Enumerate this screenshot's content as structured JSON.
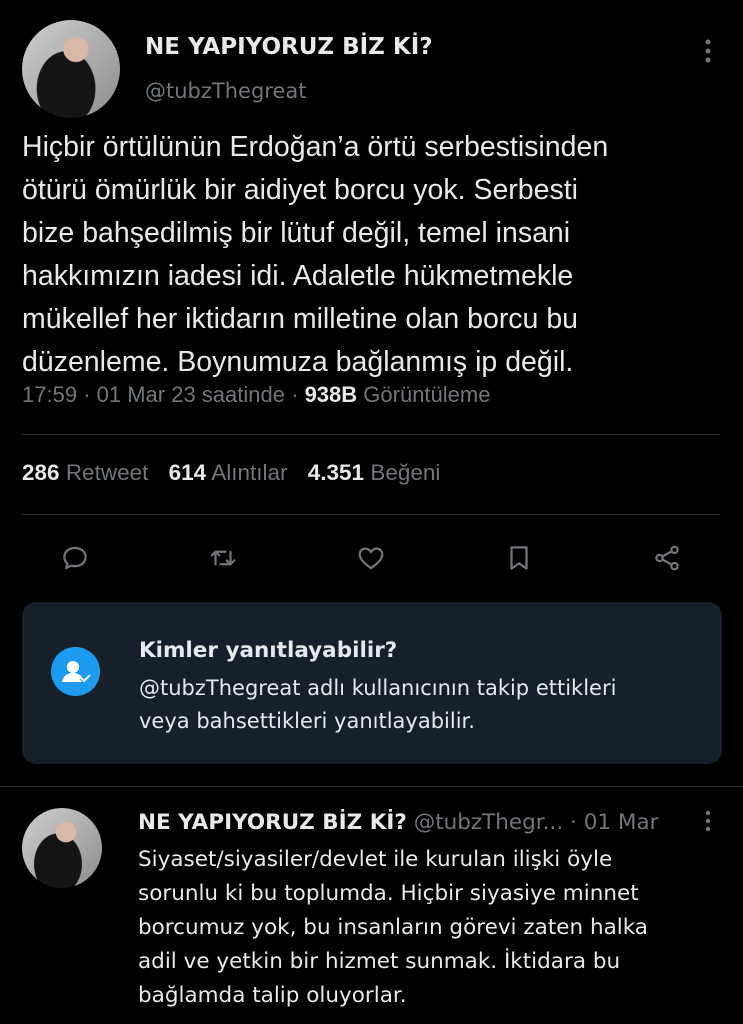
{
  "tweet": {
    "display_name": "NE YAPIYORUZ BİZ Kİ?",
    "handle": "@tubzThegreat",
    "text_lines": [
      "Hiçbir örtülünün Erdoğan’a örtü serbestisinden",
      "ötürü ömürlük bir aidiyet borcu yok. Serbesti",
      "bize bahşedilmiş bir lütuf değil, temel insani",
      "hakkımızın iadesi idi. Adaletle hükmetmekle",
      "mükellef her iktidarın milletine olan borcu bu",
      "düzenleme. Boynumuza bağlanmış ip değil."
    ],
    "time": "17:59",
    "sep1": "·",
    "date": "01 Mar 23 saatinde",
    "sep2": "·",
    "views_count": "938B",
    "views_label": "Görüntüleme",
    "stats": {
      "retweets": "286",
      "retweets_label": "Retweet",
      "quotes": "614",
      "quotes_label": "Alıntılar",
      "likes": "4.351",
      "likes_label": "Beğeni"
    }
  },
  "actions": {
    "icons": [
      "reply-icon",
      "retweet-icon",
      "like-icon",
      "bookmark-icon",
      "share-icon"
    ]
  },
  "reply_notice": {
    "title": "Kimler yanıtlayabilir?",
    "line1": "@tubzThegreat adlı kullanıcının takip ettikleri",
    "line2": "veya bahsettikleri yanıtlayabilir.",
    "accent": "#1d9bf0",
    "background": "#15202b"
  },
  "reply": {
    "display_name": "NE YAPIYORUZ BİZ Kİ?",
    "handle": "@tubzThegr...",
    "date": "· 01 Mar",
    "text_lines": [
      "Siyaset/siyasiler/devlet ile kurulan ilişki öyle",
      "sorunlu ki bu toplumda. Hiçbir siyasiye minnet",
      "borcumuz yok, bu insanların görevi zaten halka",
      "adil ve yetkin bir hizmet sunmak. İktidara bu",
      "bağlamda talip oluyorlar."
    ]
  }
}
